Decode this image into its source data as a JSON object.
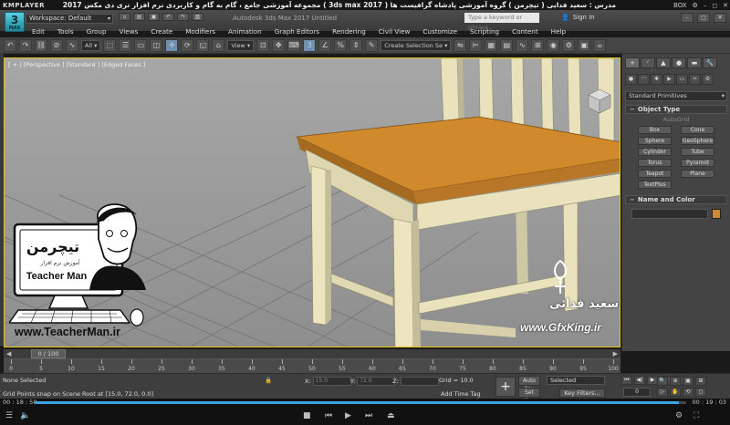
{
  "player": {
    "logo": "KMPLAYER",
    "title": "مجموعه آموزشی جامع ، گام به گام و کاربردی نرم افزار تری دی مکس 2017 ( 3ds max 2017 )   مدرس : سعید فدایی ( تیچرمن ) گروه آموزشی پادشاه گرافیست ها",
    "right_labels": [
      "BOX",
      "⚙",
      "–",
      "◻",
      "✕"
    ],
    "time_current": "00 : 18 : 50",
    "time_total": "00 : 19 : 03",
    "progress": 0.989
  },
  "app": {
    "logo_number": "3",
    "logo_label": "MAX",
    "workspace": "Workspace: Default",
    "title": "Autodesk 3ds Max 2017    Untitled",
    "search_placeholder": "Type a keyword or phrase",
    "sign_in": "Sign In"
  },
  "menu": [
    "Edit",
    "Tools",
    "Group",
    "Views",
    "Create",
    "Modifiers",
    "Animation",
    "Graph Editors",
    "Rendering",
    "Civil View",
    "Customize",
    "Scripting",
    "Content",
    "Help"
  ],
  "toolbar": {
    "filter": "All",
    "ref_coord": "View",
    "selection_set": "Create Selection Se"
  },
  "viewport": {
    "label": "[ + ] [Perspective ] [Standard ] [Edged Faces ]"
  },
  "command_panel": {
    "tabs": [
      "+",
      "◜",
      "▲",
      "●",
      "▬",
      "🔧"
    ],
    "category": "Standard Primitives",
    "object_type_title": "Object Type",
    "autogrid": "AutoGrid",
    "objects": [
      "Box",
      "Cone",
      "Sphere",
      "GeoSphere",
      "Cylinder",
      "Tube",
      "Torus",
      "Pyramid",
      "Teapot",
      "Plane",
      "TextPlus"
    ],
    "name_color_title": "Name and Color",
    "object_color": "#cc8a35"
  },
  "timeline": {
    "thumb": "0 / 100",
    "ticks": [
      "0",
      "5",
      "10",
      "15",
      "20",
      "25",
      "30",
      "35",
      "40",
      "45",
      "50",
      "55",
      "60",
      "65",
      "70",
      "75",
      "80",
      "85",
      "90",
      "95",
      "100"
    ]
  },
  "status": {
    "selection": "None Selected",
    "prompt": "Grid Points snap on Scene Root at [15.0, 72.0, 0.0]",
    "x_label": "X:",
    "x_value": "15.0",
    "y_label": "Y:",
    "y_value": "72.0",
    "z_label": "Z:",
    "grid": "Grid = 10.0",
    "time_tag": "Add Time Tag",
    "auto_key": "Auto Key",
    "set_key": "Set Key",
    "selected": "Selected",
    "key_filters": "Key Filters...",
    "frame": "0"
  },
  "overlay": {
    "teacher_brand": "تیچرمن",
    "teacher_sub": "Teacher Man",
    "teacher_tagline": "آموزش نرم افزار",
    "teacher_url": "www.TeacherMan.ir",
    "gfx_name": "سعید فدائی",
    "gfx_url": "www.GfxKing.ir"
  }
}
